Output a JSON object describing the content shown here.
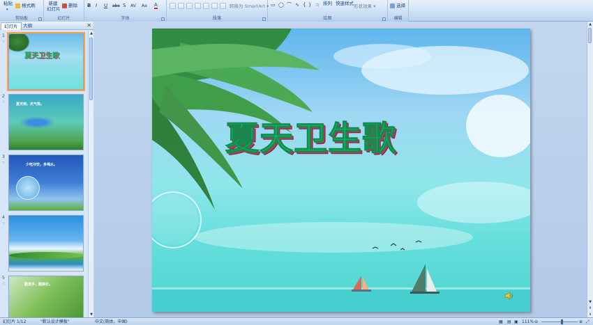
{
  "ribbon": {
    "clipboard": {
      "paste": "粘贴",
      "format_painter": "格式刷",
      "label": "剪贴板"
    },
    "slides": {
      "new_slide_1": "新建",
      "new_slide_2": "幻灯片",
      "delete": "删除",
      "label": "幻灯片"
    },
    "font": {
      "label": "字体",
      "bold": "B",
      "italic": "I",
      "underline": "U",
      "strike": "abc",
      "shadow": "S",
      "spacing": "AV",
      "case": "Aa",
      "color": "A"
    },
    "paragraph": {
      "smartart": "转换为 SmartArt",
      "label": "段落"
    },
    "drawing": {
      "arrange": "排列",
      "quick_styles": "快速样式",
      "shape_effects": "形状效果",
      "label": "绘图"
    },
    "editing": {
      "select": "选择",
      "label": "编辑"
    }
  },
  "panel": {
    "tabs": [
      "幻灯片",
      "大纲"
    ],
    "close": "✕",
    "slides": [
      {
        "num": "1",
        "text": "夏天卫生歌"
      },
      {
        "num": "2",
        "text": "夏天到，天气热，"
      },
      {
        "num": "3",
        "text": "少吃冷饮，多喝水。"
      },
      {
        "num": "4",
        "text": ""
      },
      {
        "num": "5",
        "text": "勤洗手，勤换衣，"
      }
    ]
  },
  "slide": {
    "title": "夏天卫生歌"
  },
  "status": {
    "slide_counter": "幻灯片 1/12",
    "theme": "\"默认设计模板\"",
    "language": "中文(简体，中国)",
    "zoom": "111%"
  },
  "colors": {
    "title_fill": "#1db36a",
    "title_shadow": "#b33a5a",
    "ribbon": "#c8dcf4",
    "selection": "#f4a44b"
  }
}
